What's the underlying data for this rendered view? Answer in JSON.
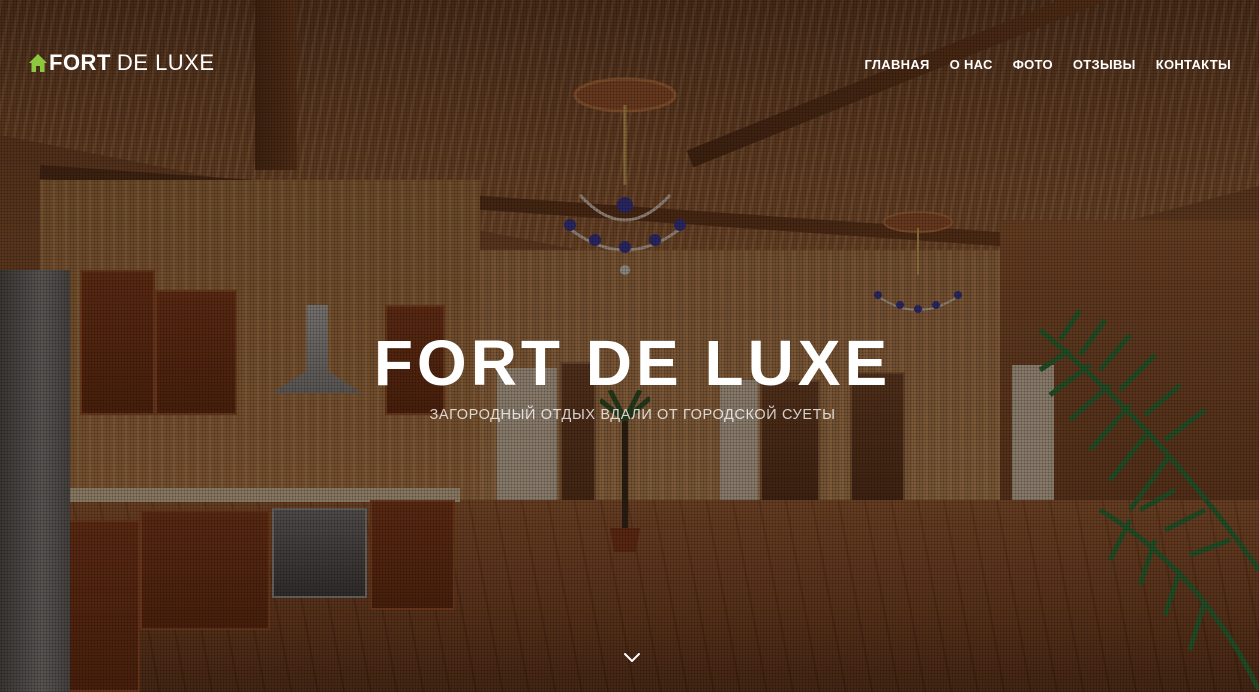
{
  "header": {
    "logo": {
      "icon": "house-icon",
      "bold_text": "FORT",
      "light_text": "DE LUXE",
      "icon_color": "#8dc63f"
    },
    "nav": [
      {
        "label": "ГЛАВНАЯ"
      },
      {
        "label": "О НАС"
      },
      {
        "label": "ФОТО"
      },
      {
        "label": "ОТЗЫВЫ"
      },
      {
        "label": "КОНТАКТЫ"
      }
    ]
  },
  "hero": {
    "title": "FORT DE LUXE",
    "subtitle": "ЗАГОРОДНЫЙ ОТДЫХ ВДАЛИ ОТ ГОРОДСКОЙ СУЕТЫ",
    "scroll_icon": "chevron-down-icon"
  }
}
